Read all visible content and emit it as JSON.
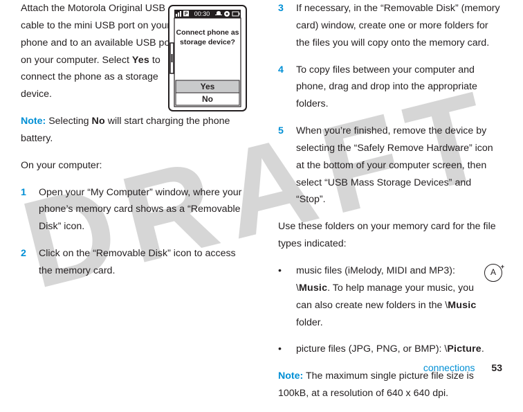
{
  "watermark": "DRAFT",
  "left": {
    "intro_before_yes": "Attach the Motorola Original USB cable to the mini USB port on your phone and to an available USB port on your computer. Select ",
    "yes_word": "Yes",
    "intro_after_yes": " to connect the phone as a storage device.",
    "note_label": "Note:",
    "note_before_no": " Selecting ",
    "no_word": "No",
    "note_after_no": " will start charging the phone battery.",
    "on_computer": "On your computer:",
    "steps": {
      "s1": {
        "n": "1",
        "t": "Open your “My Computer” window, where your phone’s memory card shows as a “Removable Disk” icon."
      },
      "s2": {
        "n": "2",
        "t": "Click on the “Removable Disk” icon to access the memory card."
      }
    },
    "phone": {
      "time": "00:30",
      "prompt_line1": "Connect phone as",
      "prompt_line2": "storage device?",
      "yes": "Yes",
      "no": "No"
    }
  },
  "right": {
    "steps": {
      "s3": {
        "n": "3",
        "t": "If necessary, in the “Removable Disk” (memory card) window, create one or more folders for the files you will copy onto the memory card."
      },
      "s4": {
        "n": "4",
        "t": "To copy files between your computer and phone, drag and drop into the appropriate folders."
      },
      "s5": {
        "n": "5",
        "t": "When you’re finished, remove the device by selecting the “Safely Remove Hardware” icon at the bottom of your computer screen, then select “USB Mass Storage Devices” and “Stop”."
      }
    },
    "folders_intro": "Use these folders on your memory card for the file types indicated:",
    "music_before": "music files (iMelody, MIDI and MP3): \\",
    "music_bold": "Music",
    "music_mid": ". To help manage your music, you can also create new folders in the \\",
    "music_bold2": "Music",
    "music_after": " folder.",
    "picture_before": "picture files (JPG, PNG, or BMP): \\",
    "picture_bold": "Picture",
    "picture_after": ".",
    "note_label": "Note:",
    "note_text": " The maximum single picture file size is 100kB, at a resolution of 640 x 640 dpi."
  },
  "footer": {
    "section": "connections",
    "page": "53"
  }
}
